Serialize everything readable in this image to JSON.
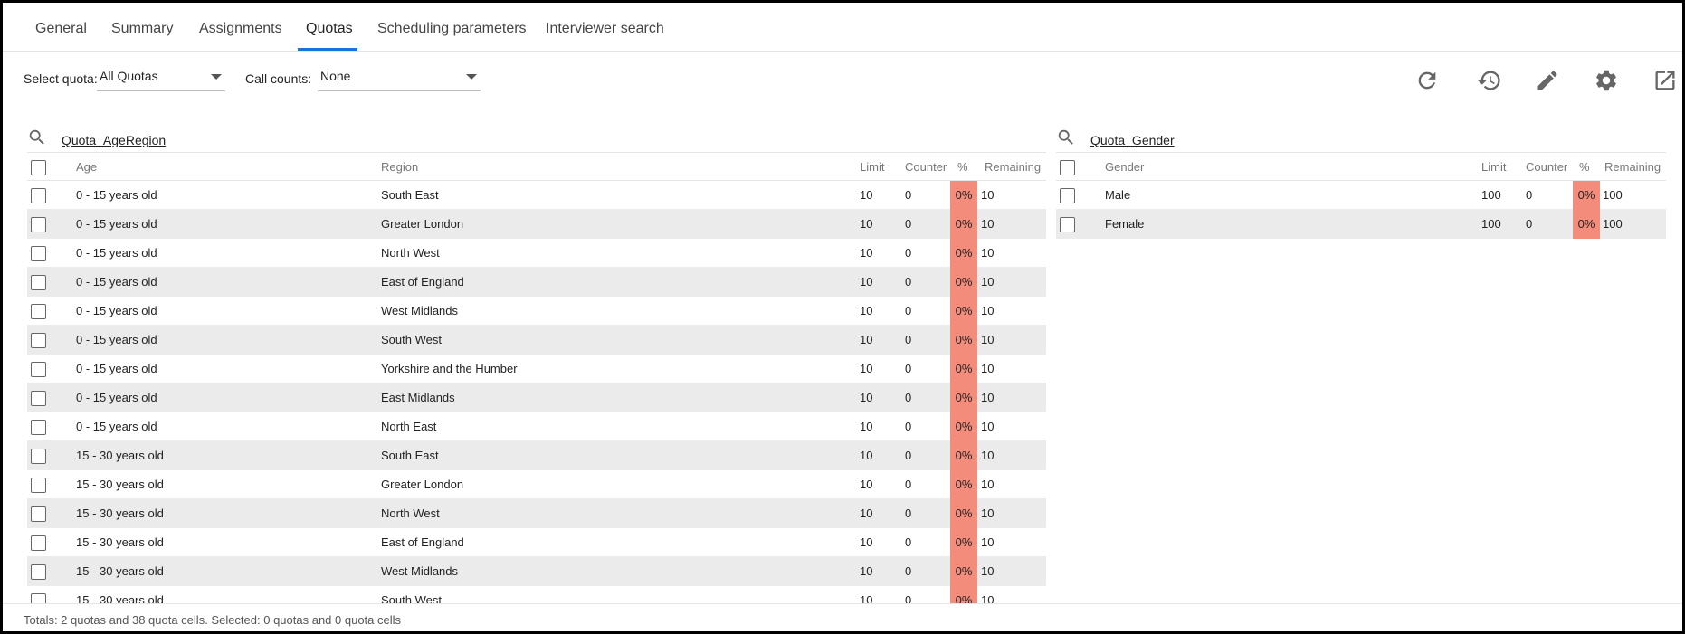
{
  "tabs": [
    {
      "label": "General"
    },
    {
      "label": "Summary"
    },
    {
      "label": "Assignments"
    },
    {
      "label": "Quotas"
    },
    {
      "label": "Scheduling parameters"
    },
    {
      "label": "Interviewer search"
    }
  ],
  "active_tab": "Quotas",
  "toolbar": {
    "select_quota_label": "Select quota:",
    "select_quota_value": "All Quotas",
    "call_counts_label": "Call counts:",
    "call_counts_value": "None",
    "icons": [
      "refresh-icon",
      "history-icon",
      "edit-icon",
      "settings-icon",
      "open-external-icon"
    ]
  },
  "colors": {
    "accent": "#1a73d9",
    "percent_cell": "#f48c7b",
    "alt_row": "#ebebeb"
  },
  "quota_age_region": {
    "title": "Quota_AgeRegion",
    "headers": {
      "age": "Age",
      "region": "Region",
      "limit": "Limit",
      "counter": "Counter",
      "pct": "%",
      "remaining": "Remaining"
    },
    "rows": [
      {
        "age": "0 - 15 years old",
        "region": "South East",
        "limit": "10",
        "counter": "0",
        "pct": "0%",
        "remaining": "10"
      },
      {
        "age": "0 - 15 years old",
        "region": "Greater London",
        "limit": "10",
        "counter": "0",
        "pct": "0%",
        "remaining": "10"
      },
      {
        "age": "0 - 15 years old",
        "region": "North West",
        "limit": "10",
        "counter": "0",
        "pct": "0%",
        "remaining": "10"
      },
      {
        "age": "0 - 15 years old",
        "region": "East of England",
        "limit": "10",
        "counter": "0",
        "pct": "0%",
        "remaining": "10"
      },
      {
        "age": "0 - 15 years old",
        "region": "West Midlands",
        "limit": "10",
        "counter": "0",
        "pct": "0%",
        "remaining": "10"
      },
      {
        "age": "0 - 15 years old",
        "region": "South West",
        "limit": "10",
        "counter": "0",
        "pct": "0%",
        "remaining": "10"
      },
      {
        "age": "0 - 15 years old",
        "region": "Yorkshire and the Humber",
        "limit": "10",
        "counter": "0",
        "pct": "0%",
        "remaining": "10"
      },
      {
        "age": "0 - 15 years old",
        "region": "East Midlands",
        "limit": "10",
        "counter": "0",
        "pct": "0%",
        "remaining": "10"
      },
      {
        "age": "0 - 15 years old",
        "region": "North East",
        "limit": "10",
        "counter": "0",
        "pct": "0%",
        "remaining": "10"
      },
      {
        "age": "15 - 30 years old",
        "region": "South East",
        "limit": "10",
        "counter": "0",
        "pct": "0%",
        "remaining": "10"
      },
      {
        "age": "15 - 30 years old",
        "region": "Greater London",
        "limit": "10",
        "counter": "0",
        "pct": "0%",
        "remaining": "10"
      },
      {
        "age": "15 - 30 years old",
        "region": "North West",
        "limit": "10",
        "counter": "0",
        "pct": "0%",
        "remaining": "10"
      },
      {
        "age": "15 - 30 years old",
        "region": "East of England",
        "limit": "10",
        "counter": "0",
        "pct": "0%",
        "remaining": "10"
      },
      {
        "age": "15 - 30 years old",
        "region": "West Midlands",
        "limit": "10",
        "counter": "0",
        "pct": "0%",
        "remaining": "10"
      },
      {
        "age": "15 - 30 years old",
        "region": "South West",
        "limit": "10",
        "counter": "0",
        "pct": "0%",
        "remaining": "10"
      }
    ]
  },
  "quota_gender": {
    "title": "Quota_Gender",
    "headers": {
      "gender": "Gender",
      "limit": "Limit",
      "counter": "Counter",
      "pct": "%",
      "remaining": "Remaining"
    },
    "rows": [
      {
        "gender": "Male",
        "limit": "100",
        "counter": "0",
        "pct": "0%",
        "remaining": "100"
      },
      {
        "gender": "Female",
        "limit": "100",
        "counter": "0",
        "pct": "0%",
        "remaining": "100"
      }
    ]
  },
  "footer": {
    "text": "Totals: 2 quotas and 38 quota cells. Selected: 0 quotas and 0 quota cells"
  }
}
